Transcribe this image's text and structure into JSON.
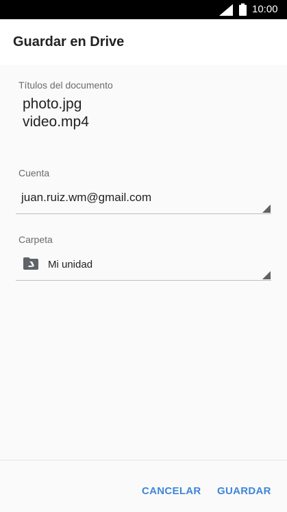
{
  "status_bar": {
    "time": "10:00",
    "icons": [
      "signal-icon",
      "battery-icon"
    ]
  },
  "app_bar": {
    "title": "Guardar en Drive"
  },
  "documents": {
    "label": "Títulos del documento",
    "names": [
      "photo.jpg",
      "video.mp4"
    ]
  },
  "account": {
    "label": "Cuenta",
    "selected": "juan.ruiz.wm@gmail.com"
  },
  "folder": {
    "label": "Carpeta",
    "selected": "Mi unidad",
    "icon": "drive-folder-icon"
  },
  "footer": {
    "cancel_label": "CANCELAR",
    "save_label": "GUARDAR"
  },
  "colors": {
    "accent": "#3d86d9",
    "status_bar": "#000000",
    "app_bar": "#ffffff",
    "background": "#fafafa",
    "text_primary": "#212121",
    "text_secondary": "#6b6b6b"
  }
}
